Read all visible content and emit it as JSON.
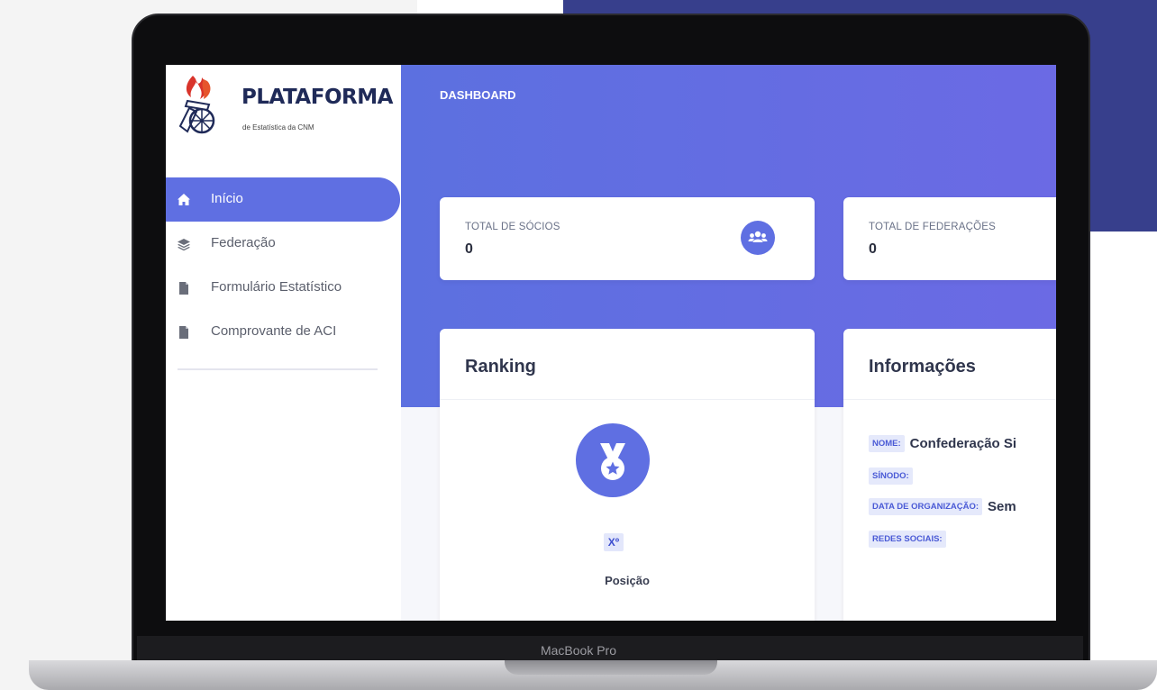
{
  "device": {
    "brand": "MacBook Pro"
  },
  "logo": {
    "title": "PLATAFORMA",
    "subtitle": "de Estatística da CNM"
  },
  "sidebar": {
    "items": [
      {
        "label": "Início",
        "icon": "home-icon",
        "active": true
      },
      {
        "label": "Federação",
        "icon": "layers-icon",
        "active": false
      },
      {
        "label": "Formulário Estatístico",
        "icon": "file-icon",
        "active": false
      },
      {
        "label": "Comprovante de ACI",
        "icon": "file-icon",
        "active": false
      }
    ]
  },
  "header": {
    "title": "DASHBOARD"
  },
  "stats": [
    {
      "label": "TOTAL DE SÓCIOS",
      "value": "0",
      "icon": "users-icon"
    },
    {
      "label": "TOTAL DE FEDERAÇÕES",
      "value": "0"
    }
  ],
  "ranking": {
    "title": "Ranking",
    "position": "Xº",
    "caption": "Posição",
    "icon": "medal-icon"
  },
  "info": {
    "title": "Informações",
    "rows": [
      {
        "tag": "NOME:",
        "value": "Confederação Si"
      },
      {
        "tag": "SÍNODO:",
        "value": ""
      },
      {
        "tag": "DATA DE ORGANIZAÇÃO:",
        "value": "Sem"
      },
      {
        "tag": "REDES SOCIAIS:",
        "value": ""
      }
    ]
  },
  "colors": {
    "accent": "#5f6fe2",
    "navy": "#373f8c",
    "text": "#30364d"
  }
}
